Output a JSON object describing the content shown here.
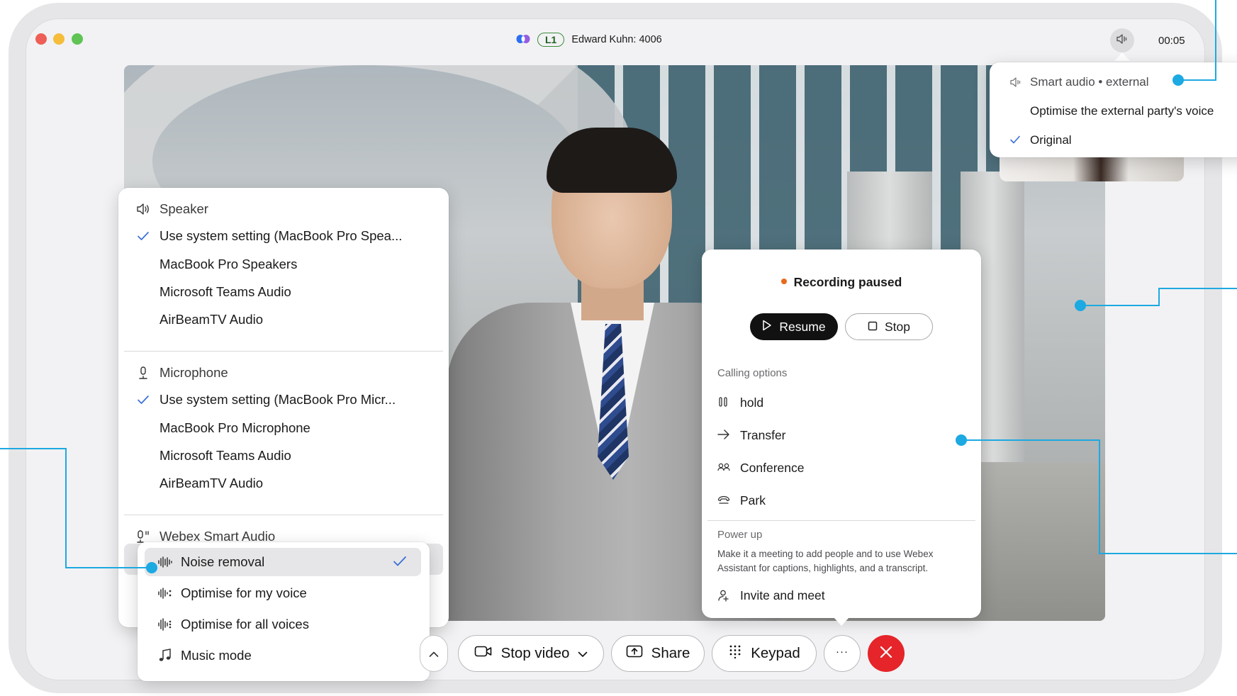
{
  "titlebar": {
    "line_badge": "L1",
    "call_title": "Edward Kuhn: 4006",
    "timer": "00:05"
  },
  "devices_menu": {
    "speaker": {
      "header": "Speaker",
      "items": [
        {
          "label": "Use system setting (MacBook Pro Spea...",
          "checked": true
        },
        {
          "label": "MacBook Pro Speakers",
          "checked": false
        },
        {
          "label": "Microsoft Teams Audio",
          "checked": false
        },
        {
          "label": "AirBeamTV Audio",
          "checked": false
        }
      ]
    },
    "microphone": {
      "header": "Microphone",
      "items": [
        {
          "label": "Use system setting (MacBook Pro Micr...",
          "checked": true
        },
        {
          "label": "MacBook Pro Microphone",
          "checked": false
        },
        {
          "label": "Microsoft Teams Audio",
          "checked": false
        },
        {
          "label": "AirBeamTV Audio",
          "checked": false
        }
      ]
    },
    "smart_audio_header": "Webex Smart Audio"
  },
  "smart_audio_submenu": {
    "items": [
      {
        "label": "Noise removal",
        "icon": "noise-removal-icon",
        "checked": true
      },
      {
        "label": "Optimise for my voice",
        "icon": "optimise-voice-icon",
        "checked": false
      },
      {
        "label": "Optimise for all voices",
        "icon": "optimise-all-voices-icon",
        "checked": false
      },
      {
        "label": "Music mode",
        "icon": "music-note-icon",
        "checked": false
      }
    ]
  },
  "more_menu": {
    "recording_status": "Recording paused",
    "resume_label": "Resume",
    "stop_label": "Stop",
    "calling_options_label": "Calling options",
    "calling_options": [
      {
        "label": "hold",
        "icon": "hold-icon"
      },
      {
        "label": "Transfer",
        "icon": "transfer-icon"
      },
      {
        "label": "Conference",
        "icon": "conference-icon"
      },
      {
        "label": "Park",
        "icon": "park-icon"
      }
    ],
    "power_up_label": "Power up",
    "power_up_text": "Make it a meeting to add people and to use Webex Assistant for captions, highlights, and a transcript.",
    "invite_label": "Invite and meet"
  },
  "audio_menu": {
    "header": "Smart audio • external",
    "items": [
      {
        "label": "Optimise the external party's voice",
        "checked": false
      },
      {
        "label": "Original",
        "checked": true
      }
    ]
  },
  "controls": {
    "stop_video_label": "Stop video",
    "share_label": "Share",
    "keypad_label": "Keypad",
    "more_label": "···"
  },
  "colors": {
    "accent_callout": "#1da9e1",
    "end_call": "#e5252a",
    "recording_dot": "#e86a1a",
    "check": "#3a6fd8"
  }
}
